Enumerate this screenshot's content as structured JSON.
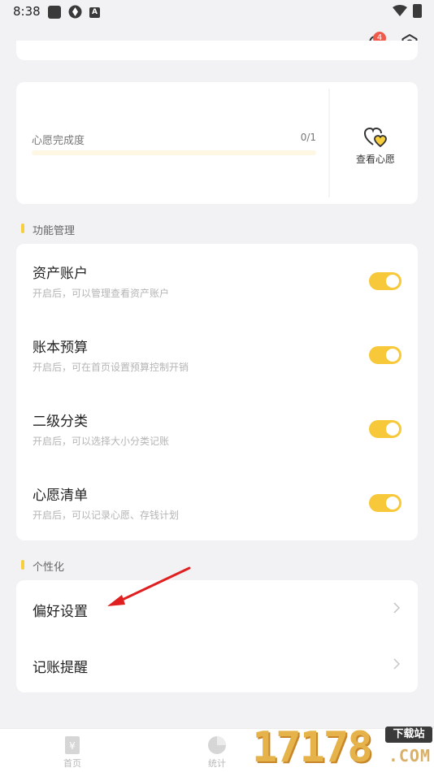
{
  "status_bar": {
    "time": "8:38",
    "app_a": "A"
  },
  "header": {
    "notification_count": "4"
  },
  "wish_card": {
    "progress_label": "心愿完成度",
    "progress_count": "0/1",
    "progress_fraction": 0.0,
    "view_label": "查看心愿"
  },
  "feature_section": {
    "title": "功能管理",
    "items": [
      {
        "title": "资产账户",
        "desc": "开启后，可以管理查看资产账户",
        "enabled": true
      },
      {
        "title": "账本预算",
        "desc": "开启后，可在首页设置预算控制开销",
        "enabled": true
      },
      {
        "title": "二级分类",
        "desc": "开启后，可以选择大小分类记账",
        "enabled": true
      },
      {
        "title": "心愿清单",
        "desc": "开启后，可以记录心愿、存钱计划",
        "enabled": true
      }
    ]
  },
  "personal_section": {
    "title": "个性化",
    "items": [
      {
        "label": "偏好设置"
      },
      {
        "label": "记账提醒"
      }
    ]
  },
  "bottom_nav": {
    "home_label": "首页",
    "stats_label": "统计"
  },
  "watermark": {
    "number": "17178",
    "badge": "下载站",
    "domain": ".COM"
  },
  "colors": {
    "accent": "#f7cf3d",
    "toggle_on": "#f7c93a",
    "badge": "#f05a4a",
    "annotation_arrow": "#e02020"
  }
}
